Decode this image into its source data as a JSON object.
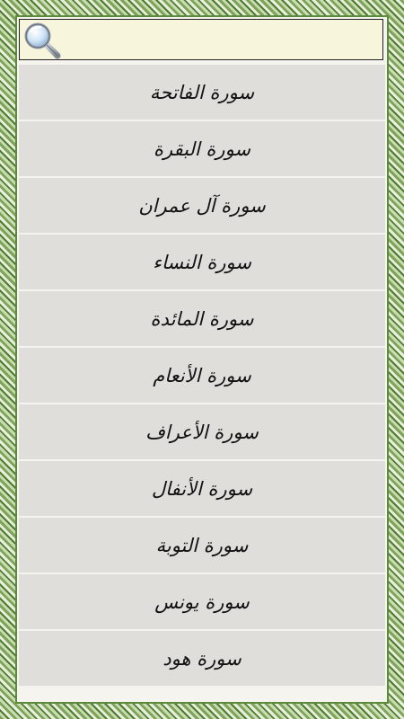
{
  "search": {
    "value": "",
    "placeholder": ""
  },
  "surahs": [
    "سورة الفاتحة",
    "سورة البقرة",
    "سورة آل عمران",
    "سورة النساء",
    "سورة المائدة",
    "سورة الأنعام",
    "سورة الأعراف",
    "سورة الأنفال",
    "سورة التوبة",
    "سورة يونس",
    "سورة هود"
  ],
  "colors": {
    "frame_green": "#5b8a3c",
    "search_bg": "#f7f5dc",
    "item_bg": "#dfdedb"
  },
  "icons": {
    "search": "magnifying-glass-icon"
  }
}
